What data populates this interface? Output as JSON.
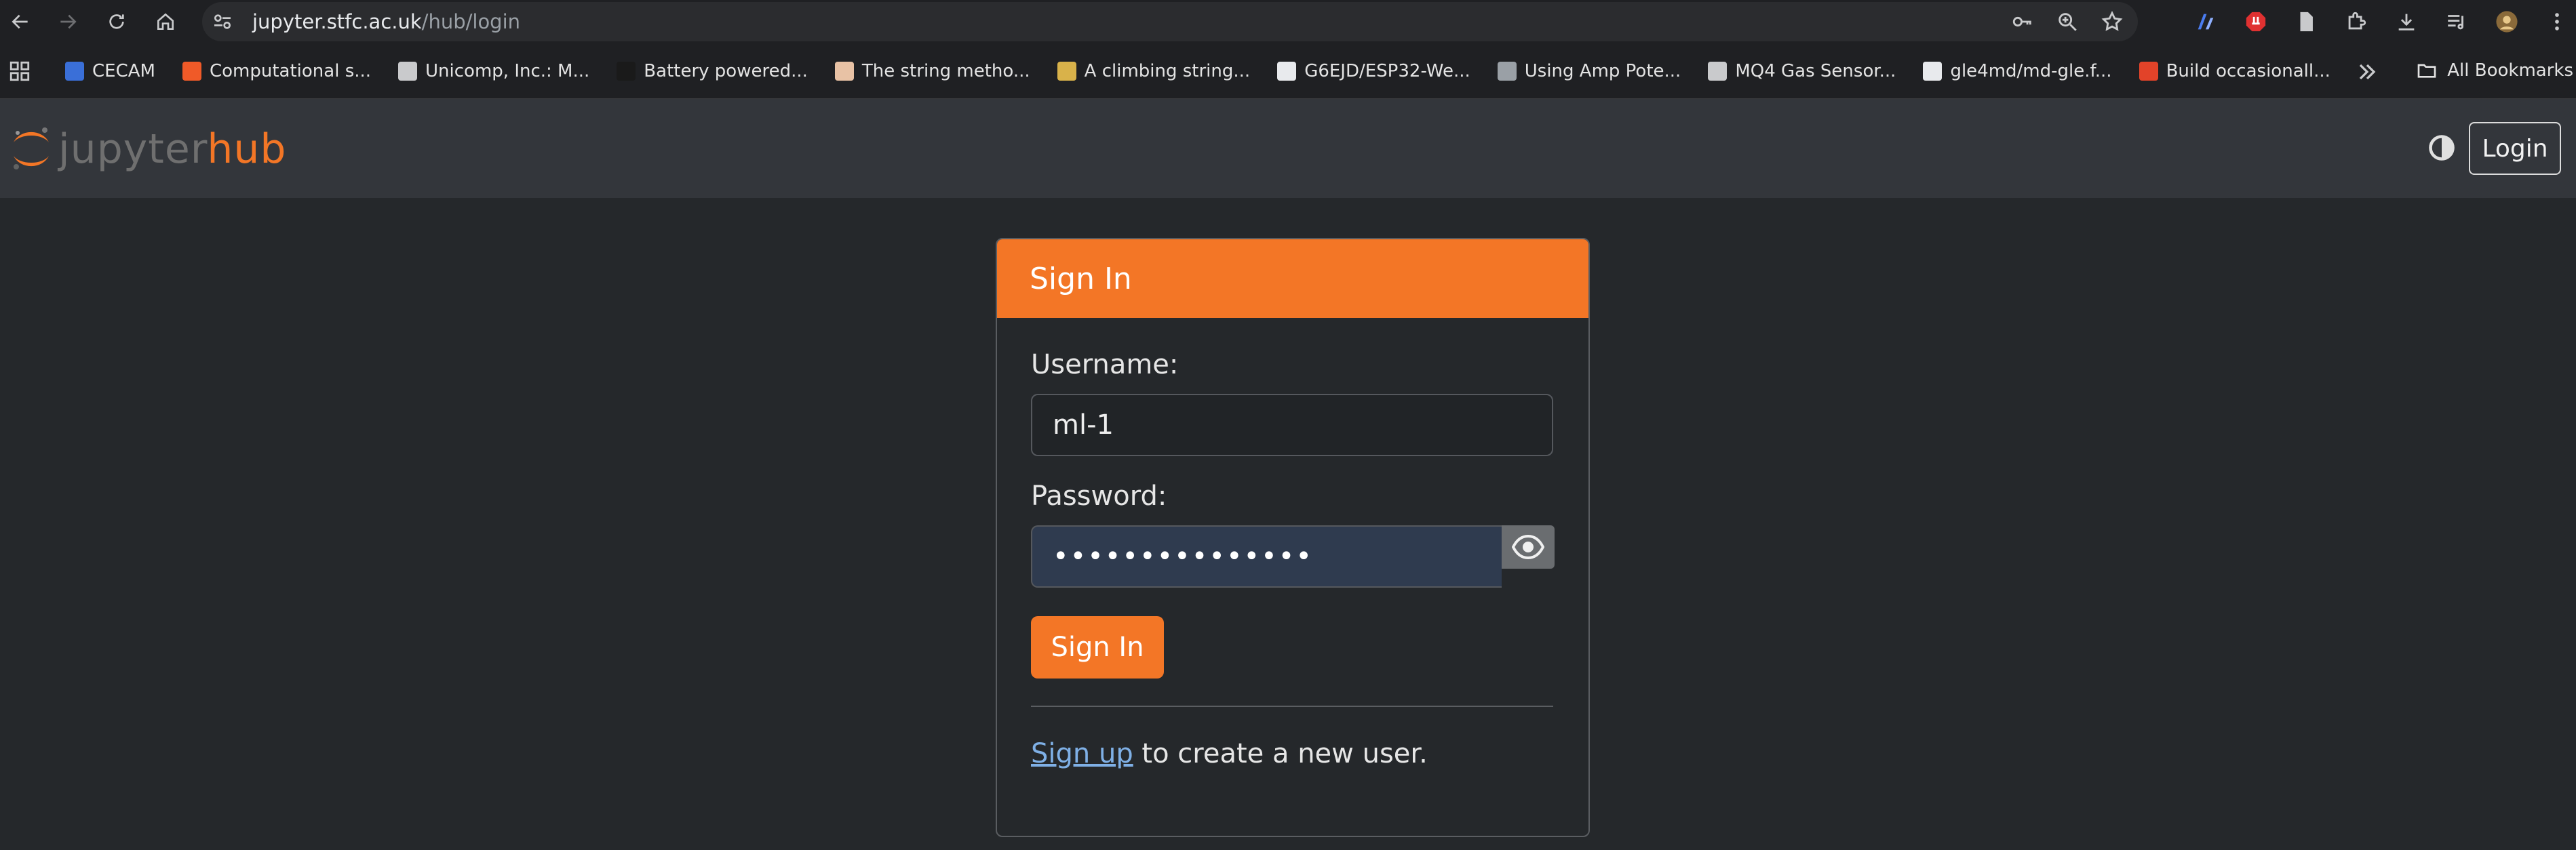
{
  "browser": {
    "url_host": "jupyter.stfc.ac.uk",
    "url_path": "/hub/login",
    "bookmarks": [
      {
        "label": "CECAM",
        "color": "#3a6fd8"
      },
      {
        "label": "Computational s...",
        "color": "#f05a28"
      },
      {
        "label": "Unicomp, Inc.: M...",
        "color": "#c9cacc"
      },
      {
        "label": "Battery powered...",
        "color": "#1a1a1a"
      },
      {
        "label": "The string metho...",
        "color": "#e8c2a5"
      },
      {
        "label": "A climbing string...",
        "color": "#d9b24a"
      },
      {
        "label": "G6EJD/ESP32-We...",
        "color": "#e8eaed"
      },
      {
        "label": "Using Amp Pote...",
        "color": "#9aa0a6"
      },
      {
        "label": "MQ4 Gas Sensor...",
        "color": "#c9cacc"
      },
      {
        "label": "gle4md/md-gle.f...",
        "color": "#e8eaed"
      },
      {
        "label": "Build occasionall...",
        "color": "#e24329"
      }
    ],
    "all_bookmarks": "All Bookmarks"
  },
  "header": {
    "logo_part1": "jupyter",
    "logo_part2": "hub",
    "login_label": "Login"
  },
  "login": {
    "title": "Sign In",
    "username_label": "Username:",
    "username_value": "ml-1",
    "password_label": "Password:",
    "password_value": "•••••••••••••••",
    "submit_label": "Sign In",
    "signup_link": "Sign up",
    "signup_suffix": " to create a new user."
  },
  "colors": {
    "accent": "#f37626",
    "background": "#25282b",
    "link": "#7fb0e6"
  }
}
